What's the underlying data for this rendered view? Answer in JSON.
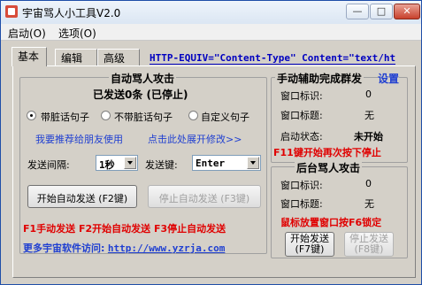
{
  "window": {
    "title": "宇宙骂人小工具V2.0"
  },
  "menu": {
    "items": [
      "启动(O)",
      "选项(O)"
    ]
  },
  "tabs": [
    "基本",
    "编辑",
    "高级"
  ],
  "scroll_text": "HTTP-EQUIV=\"Content-Type\" Content=\"text/ht",
  "auto": {
    "group_title": "自动骂人攻击",
    "status": "已发送0条 (已停止)",
    "radios": [
      "带脏话句子",
      "不带脏话句子",
      "自定义句子"
    ],
    "selected_radio": 0,
    "link_recommend": "我要推荐给朋友使用",
    "link_expand": "点击此处展开修改>>",
    "interval_label": "发送间隔:",
    "interval_value": "1秒",
    "key_label": "发送键:",
    "key_value": "Enter",
    "start_button": "开始自动发送 (F2键)",
    "stop_button": "停止自动发送 (F3键)",
    "hotkeys": "F1手动发送  F2开始自动发送  F3停止自动发送",
    "site_label": "更多宇宙软件访问:",
    "site_url": "http://www.yzrja.com"
  },
  "manual": {
    "group_title": "手动辅助完成群发",
    "settings_link": "设置",
    "rows": [
      {
        "label": "窗口标识:",
        "value": "0"
      },
      {
        "label": "窗口标题:",
        "value": "无"
      },
      {
        "label": "启动状态:",
        "value": "未开始"
      }
    ],
    "hint": "F11键开始再次按下停止"
  },
  "background": {
    "group_title": "后台骂人攻击",
    "rows": [
      {
        "label": "窗口标识:",
        "value": "0"
      },
      {
        "label": "窗口标题:",
        "value": "无"
      }
    ],
    "hint": "鼠标放置窗口按F6锁定",
    "start_line1": "开始发送",
    "start_line2": "(F7键)",
    "stop_line1": "停止发送",
    "stop_line2": "(F8键)"
  },
  "colors": {
    "link_blue": "#1f3fd1",
    "alert_red": "#e00000",
    "title_blue": "#0000c0"
  }
}
